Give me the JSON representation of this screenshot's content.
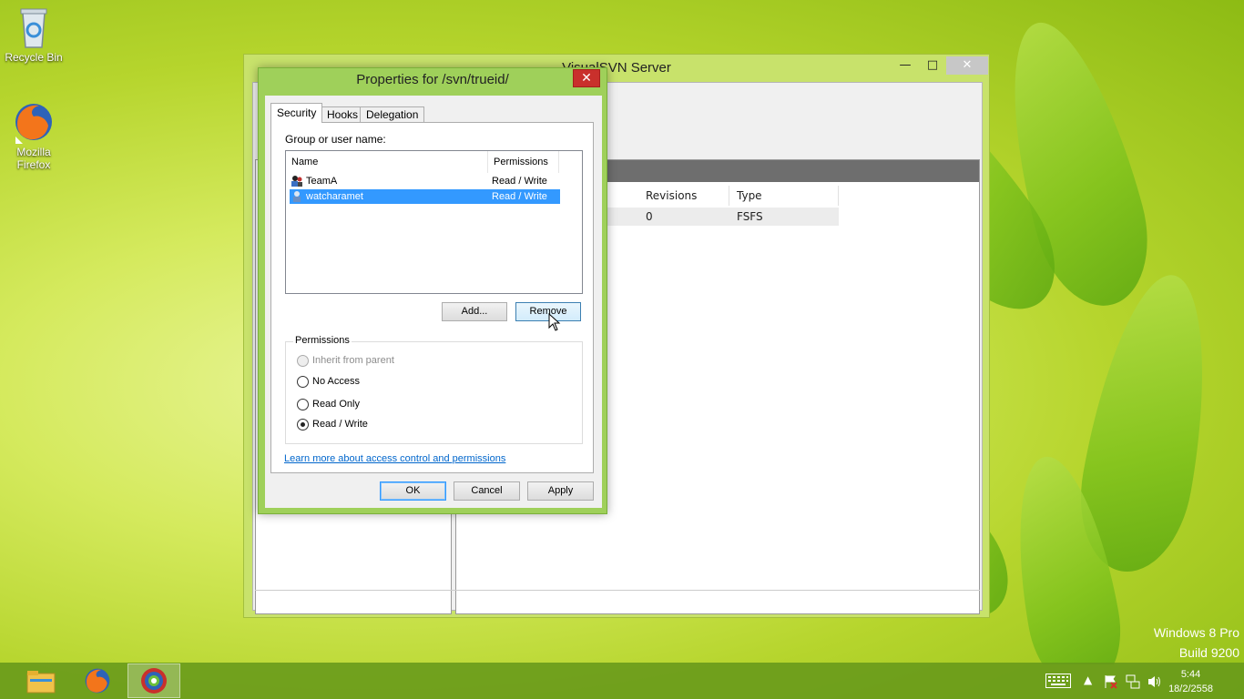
{
  "desktop": {
    "icons": [
      {
        "label": "Recycle Bin"
      },
      {
        "label": "Mozilla Firefox"
      }
    ],
    "watermark": {
      "line1": "Windows 8 Pro",
      "line2": "Build 9200"
    }
  },
  "main_window": {
    "title": "VisualSVN Server",
    "columns": [
      "Revisions",
      "Type"
    ],
    "row": {
      "revisions": "0",
      "type": "FSFS"
    }
  },
  "dialog": {
    "title": "Properties for /svn/trueid/",
    "close_label": "✕",
    "tabs": [
      "Security",
      "Hooks",
      "Delegation"
    ],
    "active_tab": "Security",
    "group_label": "Group or user name:",
    "list": {
      "headers": {
        "name": "Name",
        "permissions": "Permissions"
      },
      "rows": [
        {
          "name": "TeamA",
          "permissions": "Read / Write",
          "selected": false
        },
        {
          "name": "watcharamet",
          "permissions": "Read / Write",
          "selected": true
        }
      ]
    },
    "add_button": "Add...",
    "remove_button": "Remove",
    "permissions": {
      "title": "Permissions",
      "options": [
        {
          "label": "Inherit from parent",
          "checked": false,
          "disabled": true
        },
        {
          "label": "No Access",
          "checked": false,
          "disabled": false
        },
        {
          "label": "Read Only",
          "checked": false,
          "disabled": false
        },
        {
          "label": "Read / Write",
          "checked": true,
          "disabled": false
        }
      ]
    },
    "help_link": "Learn more about access control and permissions",
    "ok_button": "OK",
    "cancel_button": "Cancel",
    "apply_button": "Apply"
  },
  "taskbar": {
    "apps": [
      "file-explorer-icon",
      "firefox-icon",
      "visualsvn-icon"
    ],
    "clock": {
      "time": "5:44",
      "date": "18/2/2558"
    }
  },
  "colors": {
    "accent": "#9fd05a",
    "selection": "#3399ff",
    "close": "#c9302c"
  }
}
